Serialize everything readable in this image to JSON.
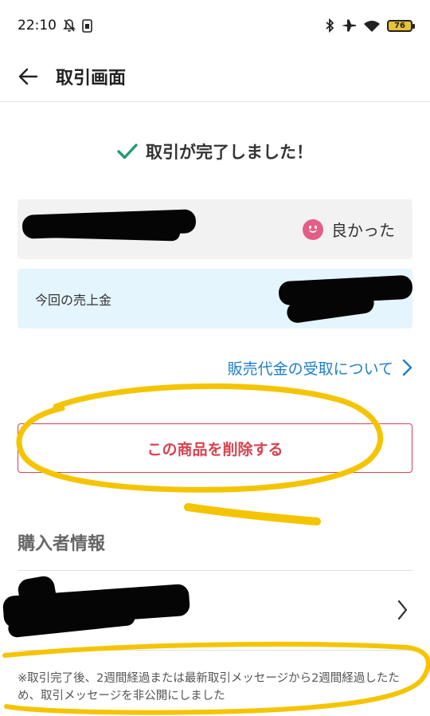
{
  "status_bar": {
    "time": "22:10",
    "battery_level": "76",
    "icons": [
      "bell-off-icon",
      "sim-icon",
      "bluetooth-icon",
      "airplane-icon",
      "wifi-icon",
      "battery-icon"
    ]
  },
  "app_bar": {
    "title": "取引画面",
    "back_icon": "arrow-left-icon"
  },
  "completion": {
    "message": "取引が完了しました！",
    "icon": "check-icon",
    "icon_color": "#1f9e6b"
  },
  "rating": {
    "label": "良かった",
    "icon": "smile-icon",
    "icon_color": "#e35d88"
  },
  "sales": {
    "label": "今回の売上金"
  },
  "receipt_link": {
    "label": "販売代金の受取について"
  },
  "delete_button": {
    "label": "この商品を削除する",
    "color": "#d8424f"
  },
  "buyer_section": {
    "heading": "購入者情報"
  },
  "notice": {
    "text": "※取引完了後、2週間経過または最新取引メッセージから2週間経過したため、取引メッセージを非公開にしました"
  },
  "colors": {
    "link": "#1f7fc9",
    "annotation": "#f5c400"
  }
}
